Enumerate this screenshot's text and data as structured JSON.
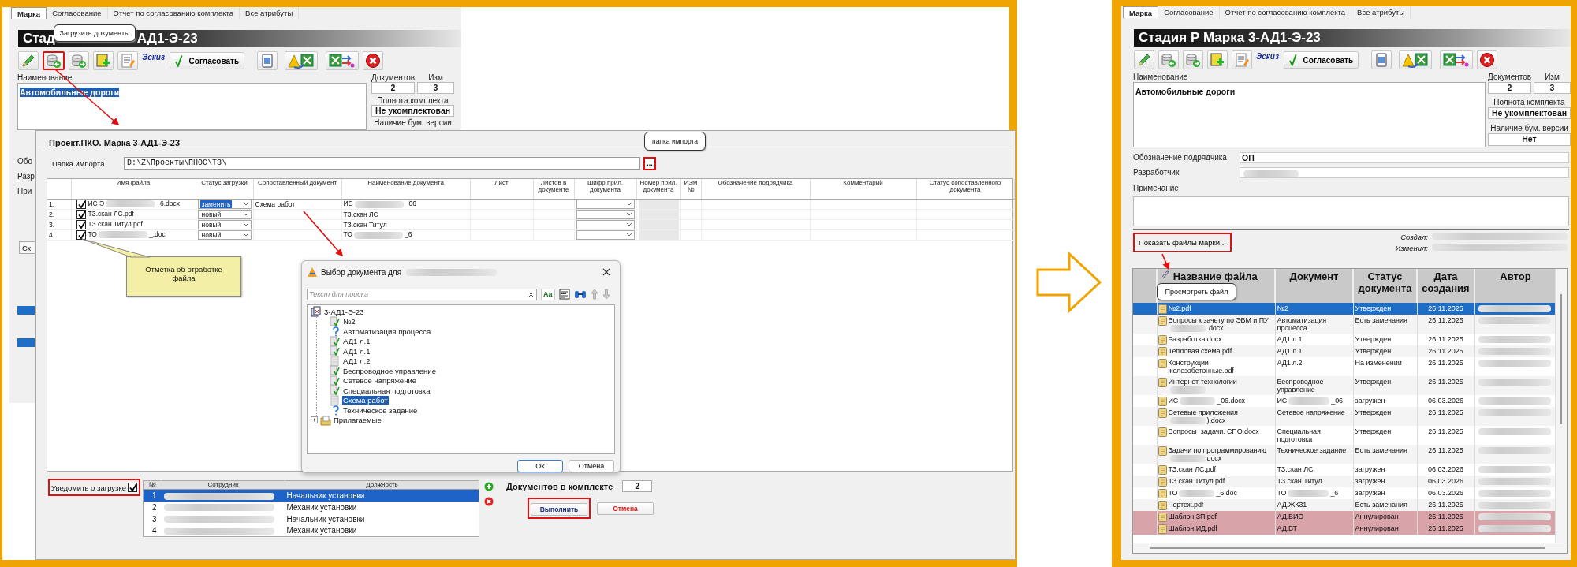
{
  "left_panel": {
    "back_window": {
      "tabs": [
        {
          "label": "Марка",
          "selected": true
        },
        {
          "label": "Согласование",
          "selected": false
        },
        {
          "label": "Отчет по согласованию комплекта",
          "selected": false
        },
        {
          "label": "Все атрибуты",
          "selected": false
        }
      ],
      "title_start": "Стад",
      "title_end": "АД1-Э-23",
      "tooltip": "Загрузить документы",
      "tools": [
        {
          "kind": "edit",
          "highlighted": false
        },
        {
          "kind": "upload",
          "highlighted": true
        },
        {
          "kind": "download",
          "highlighted": false
        },
        {
          "kind": "note",
          "highlighted": false
        },
        {
          "kind": "document",
          "highlighted": false
        },
        {
          "kind": "sketch",
          "label": "Эскиз"
        },
        {
          "kind": "approve",
          "label": "Согласовать"
        },
        {
          "kind": "word",
          "highlighted": false
        },
        {
          "kind": "warning",
          "highlighted": false
        },
        {
          "kind": "export",
          "highlighted": false
        },
        {
          "kind": "delete",
          "highlighted": false
        }
      ],
      "name_label": "Наименование",
      "name_value": "Автомобильные дороги",
      "name_selected": true,
      "documents_label": "Документов",
      "documents_value": "2",
      "revision_label": "Изм",
      "revision_value": "3",
      "completeness_label": "Полнота комплекта",
      "completeness_value": "Не укомплектован",
      "paper_label": "Наличие бум. версии",
      "side_labels": [
        "Обо",
        "Разр",
        "При"
      ],
      "side_button": "Ск"
    },
    "import_dialog": {
      "title": "Проект.ПКО. Марка 3-АД1-Э-23",
      "folder_label": "Папка импорта",
      "folder_value": "D:\\Z\\Проекты\\ПНОС\\ТЗ\\",
      "browse_button": "...",
      "browse_tooltip": "папка импорта",
      "columns": [
        "Имя файла",
        "Статус загрузки",
        "Сопоставленный документ",
        "Наименование документа",
        "Лист",
        "Листов в документе",
        "Шифр прил. документа",
        "Номер прил. документа",
        "ИЗМ №",
        "Обозначение подрядчика",
        "Комментарий",
        "Статус сопоставленного документа"
      ],
      "rows": [
        {
          "number": "1.",
          "checked": true,
          "file": [
            "ИС Э",
            {
              "kind": "redacted"
            },
            "_6.docx"
          ],
          "load_status": "заменить",
          "status_selected": true,
          "matched": "Схема работ",
          "document": [
            "ИС",
            {
              "kind": "redacted"
            },
            "_06"
          ]
        },
        {
          "number": "2.",
          "checked": true,
          "file": [
            "ТЗ.скан ЛС.pdf"
          ],
          "load_status": "новый",
          "status_selected": false,
          "document": [
            "ТЗ.скан ЛС"
          ]
        },
        {
          "number": "3.",
          "checked": true,
          "file": [
            "ТЗ.скан Титул.pdf"
          ],
          "load_status": "новый",
          "status_selected": false,
          "document": [
            "ТЗ.скан Титул"
          ]
        },
        {
          "number": "4.",
          "checked": true,
          "file": [
            "ТО",
            {
              "kind": "redacted"
            },
            "_.doc"
          ],
          "load_status": "новый",
          "status_selected": false,
          "document": [
            "ТО",
            {
              "kind": "redacted"
            },
            "_6"
          ]
        }
      ],
      "notify_label": "Уведомить о загрузке",
      "notify_checked": true,
      "staff_columns": [
        "№",
        "Сотрудник",
        "Должность"
      ],
      "staff": [
        {
          "number": "1",
          "position": "Начальник установки",
          "selected": true
        },
        {
          "number": "2",
          "position": "Механик установки",
          "selected": false
        },
        {
          "number": "3",
          "position": "Начальник установки",
          "selected": false
        },
        {
          "number": "4",
          "position": "Механик установки",
          "selected": false
        }
      ],
      "docs_in_set_label": "Документов в комплекте",
      "docs_in_set_value": "2",
      "run_button": "Выполнить",
      "cancel_button": "Отмена"
    },
    "select_dialog": {
      "title": "Выбор  документа для",
      "search_placeholder": "Текст для поиска",
      "case_button": "Aa",
      "tree": [
        {
          "label": "3-АД1-Э-23",
          "kind": "project",
          "expanded": true,
          "children": [
            {
              "label": "№2",
              "kind": "approved",
              "selected": false
            },
            {
              "label": "Автоматизация процесса",
              "kind": "question",
              "selected": false
            },
            {
              "label": "АД1 л.1",
              "kind": "approved",
              "selected": false
            },
            {
              "label": "АД1 л.1",
              "kind": "approved",
              "selected": false
            },
            {
              "label": "АД1 л.2",
              "kind": "plain",
              "selected": false
            },
            {
              "label": "Беспроводное управление",
              "kind": "approved",
              "selected": false
            },
            {
              "label": "Сетевое напряжение",
              "kind": "approved",
              "selected": false
            },
            {
              "label": "Специальная подготовка",
              "kind": "approved",
              "selected": false
            },
            {
              "label": "Схема работ",
              "kind": "plain",
              "selected": true
            },
            {
              "label": "Техническое задание",
              "kind": "question",
              "selected": false
            }
          ]
        },
        {
          "label": "Прилагаемые",
          "kind": "folder",
          "expanded": false
        }
      ],
      "ok_button": "Ok",
      "cancel_button": "Отмена"
    },
    "callout": "Отметка об отработке файла"
  },
  "right_panel": {
    "window": {
      "tabs": [
        {
          "label": "Марка",
          "selected": true
        },
        {
          "label": "Согласование",
          "selected": false
        },
        {
          "label": "Отчет по согласованию комплекта",
          "selected": false
        },
        {
          "label": "Все атрибуты",
          "selected": false
        }
      ],
      "title": "Стадия Р Марка 3-АД1-Э-23",
      "tools": [
        {
          "kind": "edit",
          "highlighted": false
        },
        {
          "kind": "upload",
          "highlighted": false
        },
        {
          "kind": "download",
          "highlighted": false
        },
        {
          "kind": "note",
          "highlighted": false
        },
        {
          "kind": "document",
          "highlighted": false
        },
        {
          "kind": "sketch",
          "label": "Эскиз"
        },
        {
          "kind": "approve",
          "label": "Согласовать"
        },
        {
          "kind": "word",
          "highlighted": false
        },
        {
          "kind": "warning",
          "highlighted": false
        },
        {
          "kind": "export",
          "highlighted": false
        },
        {
          "kind": "delete",
          "highlighted": false
        }
      ],
      "name_label": "Наименование",
      "name_value": "Автомобильные дороги",
      "name_selected": false,
      "documents_label": "Документов",
      "documents_value": "2",
      "revision_label": "Изм",
      "revision_value": "3",
      "completeness_label": "Полнота комплекта",
      "completeness_value": "Не укомплектован",
      "paper_label": "Наличие бум. версии",
      "paper_value": "Нет",
      "contractor_label": "Обозначение подрядчика",
      "contractor_value": "ОП",
      "developer_label": "Разработчик",
      "note_label": "Примечание",
      "show_files_button": "Показать файлы марки...",
      "created_label": "Создал:",
      "modified_label": "Изменил:"
    },
    "files_tooltip": "Просмотреть файл",
    "file_table": {
      "columns": [
        "Название файла",
        "Документ",
        "Статус документа",
        "Дата создания",
        "Автор"
      ],
      "rows": [
        {
          "file": [
            "№2.pdf"
          ],
          "document": [
            "№2"
          ],
          "status": "Утвержден",
          "date": "26.11.2025",
          "selected": true,
          "annulled": false
        },
        {
          "file": [
            "Вопросы к зачету по ЭВМ и ПУ",
            {
              "kind": "redacted"
            },
            ".docx"
          ],
          "document": [
            "Автоматизация процесса"
          ],
          "status": "Есть замечания",
          "date": "26.11.2025",
          "selected": false,
          "annulled": false
        },
        {
          "file": [
            "Разработка.docx"
          ],
          "document": [
            "АД1 л.1"
          ],
          "status": "Утвержден",
          "date": "26.11.2025",
          "selected": false,
          "annulled": false
        },
        {
          "file": [
            "Тепловая схема.pdf"
          ],
          "document": [
            "АД1 л.1"
          ],
          "status": "Утвержден",
          "date": "26.11.2025",
          "selected": false,
          "annulled": false
        },
        {
          "file": [
            "Конструкции железобетонные.pdf"
          ],
          "document": [
            "АД1 л.2"
          ],
          "status": "На изменении",
          "date": "26.11.2025",
          "selected": false,
          "annulled": false
        },
        {
          "file": [
            "Интернет-технологии",
            {
              "kind": "redacted"
            }
          ],
          "document": [
            "Беспроводное управление"
          ],
          "status": "Утвержден",
          "date": "26.11.2025",
          "selected": false,
          "annulled": false
        },
        {
          "file": [
            "ИС",
            {
              "kind": "redacted"
            },
            "_06.docx"
          ],
          "document": [
            "ИС",
            {
              "kind": "redacted"
            },
            "_06"
          ],
          "status": "загружен",
          "date": "06.03.2026",
          "selected": false,
          "annulled": false
        },
        {
          "file": [
            "Сетевые приложения",
            {
              "kind": "redacted"
            },
            ").docx"
          ],
          "document": [
            "Сетевое напряжение"
          ],
          "status": "Утвержден",
          "date": "26.11.2025",
          "selected": false,
          "annulled": false
        },
        {
          "file": [
            "Вопросы+задачи. СПО.docx"
          ],
          "document": [
            "Специальная подготовка"
          ],
          "status": "Утвержден",
          "date": "26.11.2025",
          "selected": false,
          "annulled": false
        },
        {
          "file": [
            "Задачи по программированию",
            {
              "kind": "redacted"
            },
            "docx"
          ],
          "document": [
            "Техническое задание"
          ],
          "status": "Есть замечания",
          "date": "26.11.2025",
          "selected": false,
          "annulled": false
        },
        {
          "file": [
            "ТЗ.скан ЛС.pdf"
          ],
          "document": [
            "ТЗ.скан ЛС"
          ],
          "status": "загружен",
          "date": "06.03.2026",
          "selected": false,
          "annulled": false
        },
        {
          "file": [
            "ТЗ.скан Титул.pdf"
          ],
          "document": [
            "ТЗ.скан Титул"
          ],
          "status": "загружен",
          "date": "06.03.2026",
          "selected": false,
          "annulled": false
        },
        {
          "file": [
            "ТО",
            {
              "kind": "redacted"
            },
            "_6.doc"
          ],
          "document": [
            "ТО",
            {
              "kind": "redacted"
            },
            "_6"
          ],
          "status": "загружен",
          "date": "06.03.2026",
          "selected": false,
          "annulled": false
        },
        {
          "file": [
            "Чертеж.pdf"
          ],
          "document": [
            "АД.ЖК31"
          ],
          "status": "Есть замечания",
          "date": "26.11.2025",
          "selected": false,
          "annulled": false
        },
        {
          "file": [
            "Шаблон ЗП.pdf"
          ],
          "document": [
            "АД.ВИО"
          ],
          "status": "Аннулирован",
          "date": "26.11.2025",
          "selected": false,
          "annulled": true
        },
        {
          "file": [
            "Шаблон ИД.pdf"
          ],
          "document": [
            "АД.ВТ"
          ],
          "status": "Аннулирован",
          "date": "26.11.2025",
          "selected": false,
          "annulled": true
        }
      ]
    }
  }
}
